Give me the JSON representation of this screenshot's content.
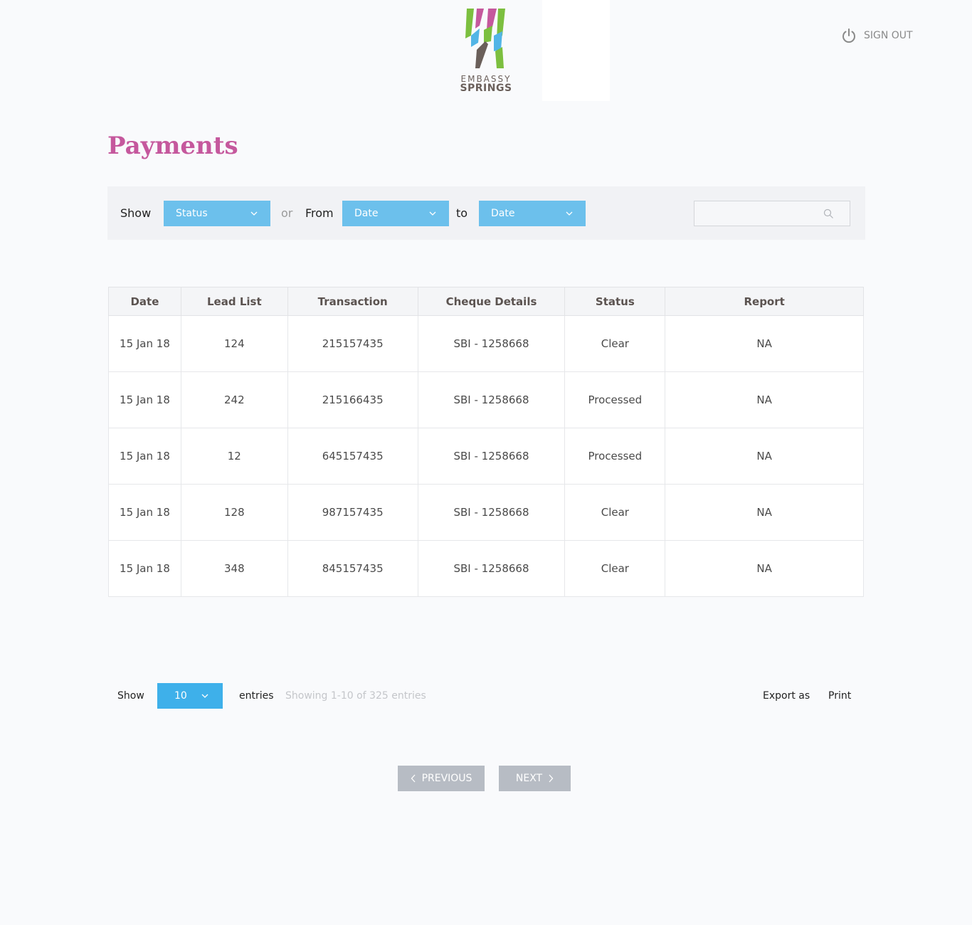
{
  "header": {
    "logo_line1": "EMBASSY",
    "logo_line2": "SPRINGS",
    "signout_label": "SIGN OUT"
  },
  "page": {
    "title": "Payments"
  },
  "filters": {
    "show_label": "Show",
    "status_value": "Status",
    "or_label": "or",
    "from_label": "From",
    "from_value": "Date",
    "to_label": "to",
    "to_value": "Date",
    "search_placeholder": ""
  },
  "table": {
    "headers": [
      "Date",
      "Lead List",
      "Transaction",
      "Cheque Details",
      "Status",
      "Report"
    ],
    "rows": [
      [
        "15 Jan 18",
        "124",
        "215157435",
        "SBI - 1258668",
        "Clear",
        "NA"
      ],
      [
        "15 Jan 18",
        "242",
        "215166435",
        "SBI - 1258668",
        "Processed",
        "NA"
      ],
      [
        "15 Jan 18",
        "12",
        "645157435",
        "SBI - 1258668",
        "Processed",
        "NA"
      ],
      [
        "15 Jan 18",
        "128",
        "987157435",
        "SBI - 1258668",
        "Clear",
        "NA"
      ],
      [
        "15 Jan 18",
        "348",
        "845157435",
        "SBI - 1258668",
        "Clear",
        "NA"
      ]
    ]
  },
  "footer": {
    "show_label": "Show",
    "entries_value": "10",
    "entries_label": "entries",
    "showing_text": "Showing 1-10 of 325 entries",
    "export_label": "Export as",
    "print_label": "Print"
  },
  "pagination": {
    "previous_label": "PREVIOUS",
    "next_label": "NEXT"
  },
  "colors": {
    "title": "#c5589d",
    "dropdown": "#6cc0ec",
    "entries_dropdown": "#3eb0ea",
    "pager": "#b7bcc4"
  }
}
